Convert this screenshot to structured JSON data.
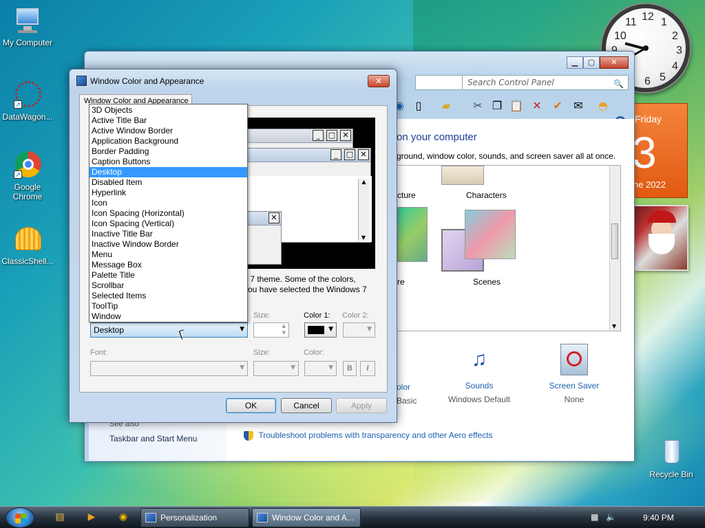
{
  "desktop": {
    "icons": [
      {
        "label": "My Computer"
      },
      {
        "label": "DataWagon..."
      },
      {
        "label": "Google Chrome"
      },
      {
        "label": "ClassicShell..."
      },
      {
        "label": "Recycle Bin"
      }
    ]
  },
  "clock": {
    "numbers": [
      "12",
      "1",
      "2",
      "3",
      "4",
      "5",
      "6",
      "7",
      "8",
      "9",
      "10",
      "11"
    ]
  },
  "calendar": {
    "weekday": "Friday",
    "day": "3",
    "month_year": "ne 2022"
  },
  "control_panel": {
    "search_placeholder": "Search Control Panel",
    "heading": "on your computer",
    "subheading": "ground, window color, sounds, and screen saver all at once.",
    "themes": [
      {
        "label": "cture"
      },
      {
        "label": "Characters"
      },
      {
        "label": "re"
      },
      {
        "label": "Scenes"
      }
    ],
    "bottom_items": [
      {
        "label": "olor",
        "value": "Basic"
      },
      {
        "label": "Sounds",
        "value": "Windows Default"
      },
      {
        "label": "Screen Saver",
        "value": "None"
      }
    ],
    "see_also": "See also",
    "left_link": "Taskbar and Start Menu",
    "troubleshoot_link": "Troubleshoot problems with transparency and other Aero effects"
  },
  "dialog": {
    "title": "Window Color and Appearance",
    "tab": "Window Color and Appearance",
    "description_line1": "s 7 theme.  Some of the colors,",
    "description_line2": "you have selected the Windows 7",
    "item_selected": "Desktop",
    "labels": {
      "size": "Size:",
      "color1": "Color 1:",
      "color2": "Color 2:",
      "font": "Font:",
      "font_size": "Size:",
      "font_color": "Color:",
      "bold": "B",
      "italic": "I"
    },
    "buttons": {
      "ok": "OK",
      "cancel": "Cancel",
      "apply": "Apply"
    },
    "dropdown_items": [
      "3D Objects",
      "Active Title Bar",
      "Active Window Border",
      "Application Background",
      "Border Padding",
      "Caption Buttons",
      "Desktop",
      "Disabled Item",
      "Hyperlink",
      "Icon",
      "Icon Spacing (Horizontal)",
      "Icon Spacing (Vertical)",
      "Inactive Title Bar",
      "Inactive Window Border",
      "Menu",
      "Message Box",
      "Palette Title",
      "Scrollbar",
      "Selected Items",
      "ToolTip",
      "Window"
    ],
    "selected_index": 6
  },
  "taskbar": {
    "tasks": [
      {
        "label": "Personalization"
      },
      {
        "label": "Window Color and A..."
      }
    ],
    "time": "9:40 PM"
  },
  "colors": {
    "selection": "#3399ff",
    "link": "#1a5fb0",
    "heading": "#1e3c96"
  }
}
